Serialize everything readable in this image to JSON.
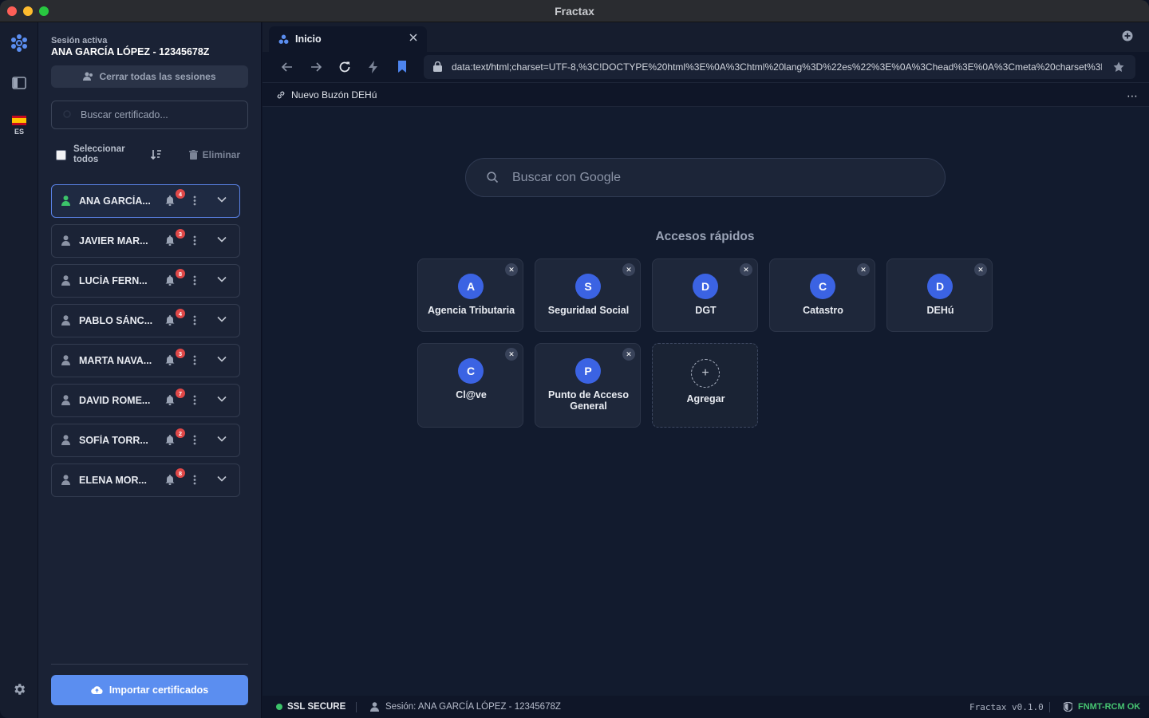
{
  "window": {
    "title": "Fractax"
  },
  "rail": {
    "lang": "ES"
  },
  "sidebar": {
    "session_label": "Sesión activa",
    "session_name": "ANA GARCÍA LÓPEZ - 12345678Z",
    "close_all": "Cerrar todas las sesiones",
    "search_placeholder": "Buscar certificado...",
    "select_all": "Seleccionar todos",
    "delete": "Eliminar",
    "items": [
      {
        "name": "ANA GARCÍA...",
        "badge": "4",
        "active": true
      },
      {
        "name": "JAVIER MAR...",
        "badge": "3",
        "active": false
      },
      {
        "name": "LUCÍA FERN...",
        "badge": "8",
        "active": false
      },
      {
        "name": "PABLO SÁNC...",
        "badge": "4",
        "active": false
      },
      {
        "name": "MARTA NAVA...",
        "badge": "3",
        "active": false
      },
      {
        "name": "DAVID ROME...",
        "badge": "7",
        "active": false
      },
      {
        "name": "SOFÍA TORR...",
        "badge": "2",
        "active": false
      },
      {
        "name": "ELENA MOR...",
        "badge": "8",
        "active": false
      }
    ],
    "import": "Importar certificados"
  },
  "browser": {
    "tab_title": "Inicio",
    "url": "data:text/html;charset=UTF-8,%3C!DOCTYPE%20html%3E%0A%3Chtml%20lang%3D%22es%22%3E%0A%3Chead%3E%0A%3Cmeta%20charset%3D",
    "bookmark": "Nuevo Buzón DEHú",
    "search_placeholder": "Buscar con Google",
    "quick_title": "Accesos rápidos",
    "tiles": [
      {
        "letter": "A",
        "label": "Agencia Tributaria"
      },
      {
        "letter": "S",
        "label": "Seguridad Social"
      },
      {
        "letter": "D",
        "label": "DGT"
      },
      {
        "letter": "C",
        "label": "Catastro"
      },
      {
        "letter": "D",
        "label": "DEHú"
      },
      {
        "letter": "C",
        "label": "Cl@ve"
      },
      {
        "letter": "P",
        "label": "Punto de Acceso General"
      }
    ],
    "add_label": "Agregar"
  },
  "status": {
    "ssl": "SSL SECURE",
    "session": "Sesión: ANA GARCÍA LÓPEZ - 12345678Z",
    "version": "Fractax v0.1.0",
    "fnmt": "FNMT-RCM OK"
  },
  "colors": {
    "accent": "#5b8ef0",
    "tile_circle": "#3b63e3",
    "ok": "#46c371",
    "badge": "#e04848"
  }
}
